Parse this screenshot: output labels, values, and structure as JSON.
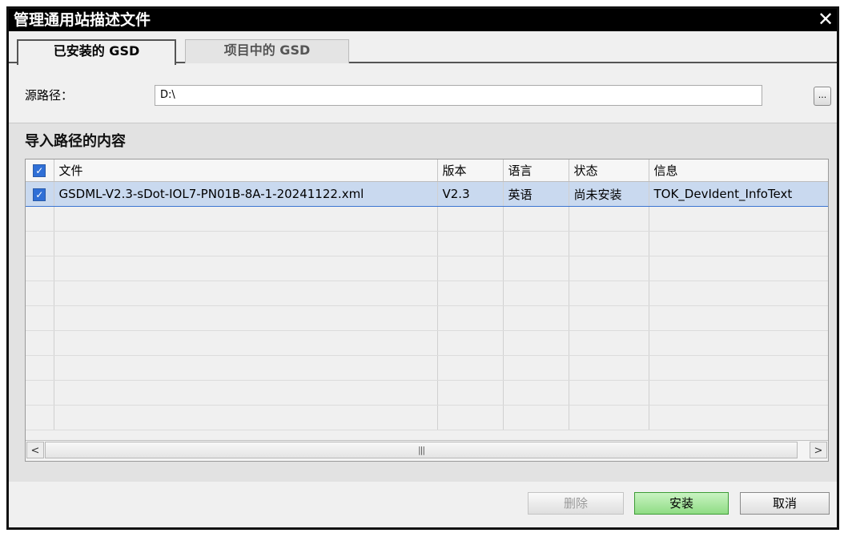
{
  "window": {
    "title": "管理通用站描述文件",
    "close_glyph": "✕"
  },
  "tabs": [
    {
      "label": "已安装的 GSD",
      "active": true
    },
    {
      "label": "项目中的 GSD",
      "active": false
    }
  ],
  "source": {
    "label": "源路径：",
    "value": "D:\\",
    "browse_label": "..."
  },
  "content": {
    "title": "导入路径的内容"
  },
  "table": {
    "columns": [
      "文件",
      "版本",
      "语言",
      "状态",
      "信息"
    ],
    "rows": [
      {
        "checked": true,
        "file": "GSDML-V2.3-sDot-IOL7-PN01B-8A-1-20241122.xml",
        "version": "V2.3",
        "language": "英语",
        "status": "尚未安装",
        "info": "TOK_DevIdent_InfoText"
      }
    ]
  },
  "scrollbar": {
    "left": "<",
    "right": ">",
    "thumb": "|||"
  },
  "buttons": {
    "delete": "删除",
    "install": "安装",
    "cancel": "取消"
  },
  "colors": {
    "title_bar": "#000000",
    "selection": "#c9d9ef",
    "install_button": "#8fdc84"
  }
}
